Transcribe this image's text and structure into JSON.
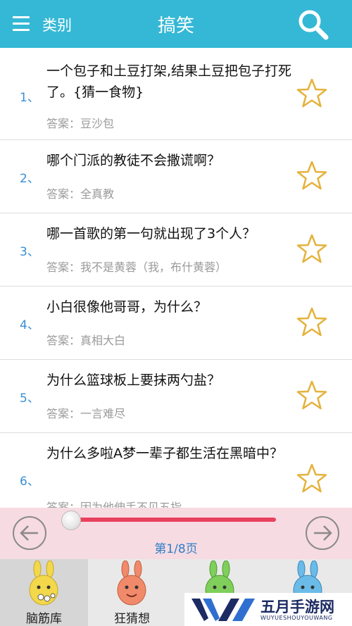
{
  "header": {
    "category_label": "类别",
    "title": "搞笑",
    "menu_icon": "menu-icon",
    "search_icon": "search-icon",
    "bg_color": "#35b8d5"
  },
  "riddles": [
    {
      "num": "1、",
      "question": "一个包子和土豆打架,结果土豆把包子打死了。{猜一食物}",
      "answer": "答案：豆沙包"
    },
    {
      "num": "2、",
      "question": "哪个门派的教徒不会撒谎啊？",
      "answer": "答案：全真教"
    },
    {
      "num": "3、",
      "question": "哪一首歌的第一句就出现了3个人？",
      "answer": "答案：我不是黄蓉（我，布什黄蓉）"
    },
    {
      "num": "4、",
      "question": "小白很像他哥哥，为什么？",
      "answer": "答案：真相大白"
    },
    {
      "num": "5、",
      "question": "为什么篮球板上要抹两勺盐？",
      "answer": "答案：一言难尽"
    },
    {
      "num": "6、",
      "question": "为什么多啦A梦一辈子都生活在黑暗中？",
      "answer": "答案：因为他伸手不见五指"
    }
  ],
  "pager": {
    "page_text": "第1/8页",
    "prev_icon": "arrow-left-icon",
    "next_icon": "arrow-right-icon",
    "progress_fraction": 0.0
  },
  "tabs": [
    {
      "label": "脑筋库",
      "active": true,
      "color": "#f2d84a"
    },
    {
      "label": "狂猜想",
      "active": false,
      "color": "#f08a6a"
    },
    {
      "label": "",
      "active": false,
      "color": "#7fcf5a"
    },
    {
      "label": "",
      "active": false,
      "color": "#6bbbe8"
    }
  ],
  "watermark": {
    "title": "五月手游网",
    "subtitle": "WUYUESHOUYOUWANG"
  }
}
